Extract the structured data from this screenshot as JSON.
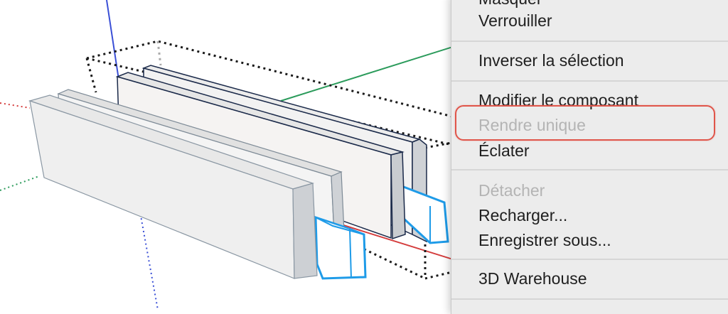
{
  "viewport": {
    "accent": "#1e9be8",
    "axis_colors": {
      "red": "#d43c3c",
      "green": "#2b9b5b",
      "blue": "#3a4fd6"
    }
  },
  "context_menu": {
    "items": [
      {
        "label": "Masquer",
        "enabled": true
      },
      {
        "label": "Verrouiller",
        "enabled": true
      },
      {
        "label": "Inverser la sélection",
        "enabled": true
      },
      {
        "label": "Modifier le composant",
        "enabled": true
      },
      {
        "label": "Rendre unique",
        "enabled": false,
        "highlighted": true
      },
      {
        "label": "Éclater",
        "enabled": true
      },
      {
        "label": "Détacher",
        "enabled": false
      },
      {
        "label": "Recharger...",
        "enabled": true
      },
      {
        "label": "Enregistrer sous...",
        "enabled": true
      },
      {
        "label": "3D Warehouse",
        "enabled": true
      }
    ],
    "highlight_color": "#e0554a"
  }
}
